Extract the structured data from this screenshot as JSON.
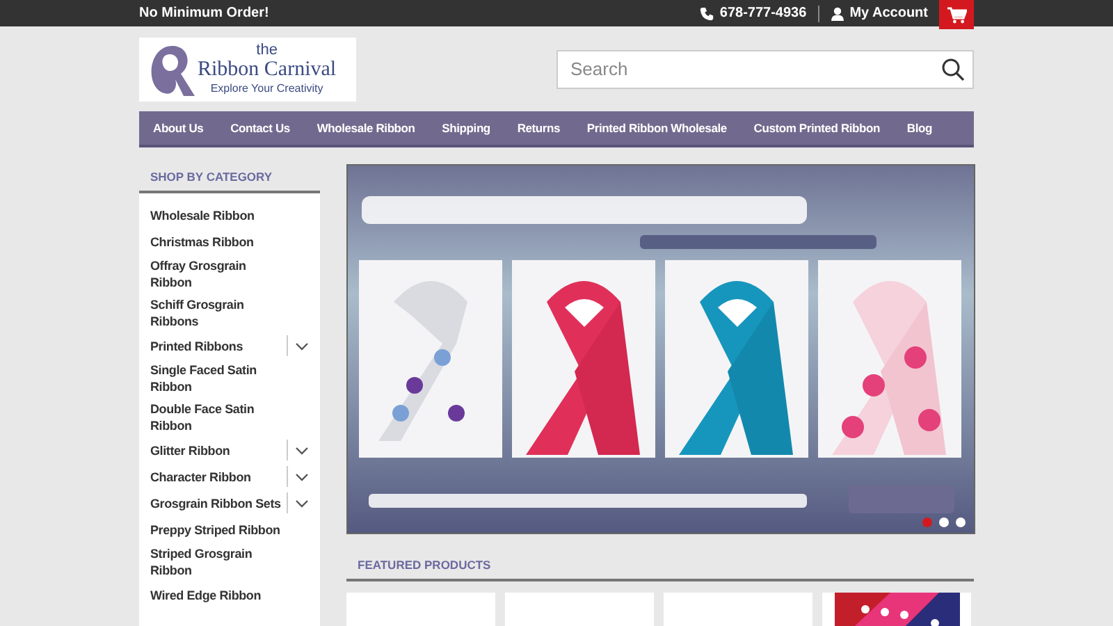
{
  "top_bar": {
    "promo": "No Minimum Order!",
    "phone": "678-777-4936",
    "account": "My Account"
  },
  "logo": {
    "word_1": "the",
    "word_2": "Ribbon Carnival",
    "tagline": "Explore Your Creativity"
  },
  "search": {
    "placeholder": "Search"
  },
  "nav": [
    "About Us",
    "Contact Us",
    "Wholesale Ribbon",
    "Shipping",
    "Returns",
    "Printed Ribbon Wholesale",
    "Custom Printed Ribbon",
    "Blog"
  ],
  "sidebar": {
    "title": "SHOP BY CATEGORY",
    "items": [
      {
        "label": "Wholesale Ribbon",
        "kind": "link"
      },
      {
        "label": "Christmas Ribbon",
        "kind": "link"
      },
      {
        "label": "Offray Grosgrain Ribbon",
        "kind": "link"
      },
      {
        "label": "Schiff Grosgrain Ribbons",
        "kind": "link"
      },
      {
        "label": "Printed Ribbons",
        "kind": "parent"
      },
      {
        "label": "Single Faced Satin Ribbon",
        "kind": "link"
      },
      {
        "label": "Double Face Satin Ribbon",
        "kind": "link"
      },
      {
        "label": "Glitter Ribbon",
        "kind": "parent"
      },
      {
        "label": "Character Ribbon",
        "kind": "parent"
      },
      {
        "label": "Grosgrain Ribbon Sets",
        "kind": "parent"
      },
      {
        "label": "Preppy Striped Ribbon",
        "kind": "link"
      },
      {
        "label": "Striped Grosgrain Ribbon",
        "kind": "link"
      },
      {
        "label": "Wired Edge Ribbon",
        "kind": "link"
      }
    ]
  },
  "carousel": {
    "slides": [
      {
        "selected": true
      },
      {
        "selected": false
      },
      {
        "selected": false
      }
    ]
  },
  "featured": {
    "title": "FEATURED PRODUCTS",
    "items": [
      {
        "kind": "blank"
      },
      {
        "kind": "blank"
      },
      {
        "kind": "blank"
      },
      {
        "kind": "photo"
      }
    ]
  }
}
